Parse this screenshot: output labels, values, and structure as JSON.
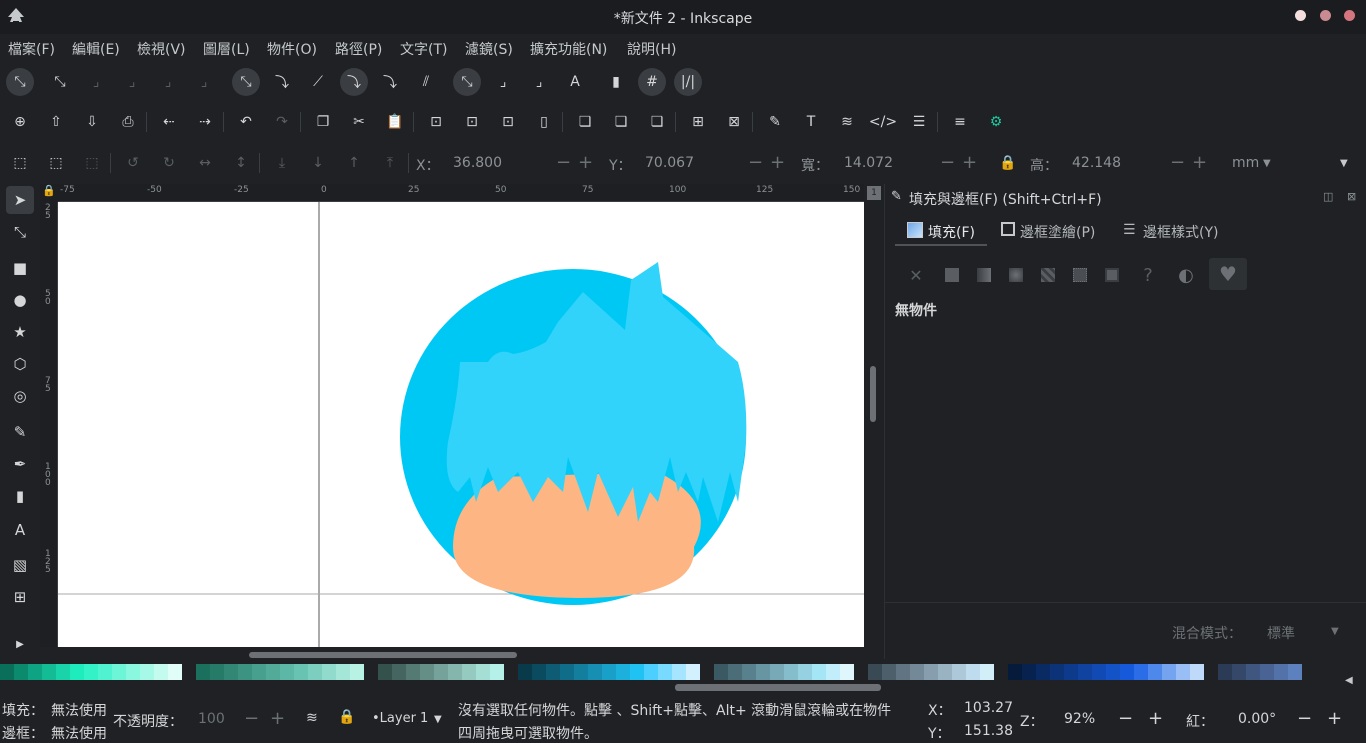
{
  "window": {
    "title": "*新文件 2 - Inkscape"
  },
  "menu": [
    "檔案(F)",
    "編輯(E)",
    "檢視(V)",
    "圖層(L)",
    "物件(O)",
    "路徑(P)",
    "文字(T)",
    "濾鏡(S)",
    "擴充功能(N)",
    "說明(H)"
  ],
  "tool_controls": {
    "x_label": "X：",
    "x_value": "36.800",
    "y_label": "Y：",
    "y_value": "70.067",
    "w_label": "寬：",
    "w_value": "14.072",
    "h_label": "高：",
    "h_value": "42.148",
    "unit": "mm"
  },
  "ruler_top_labels": [
    "-75",
    "-50",
    "-25",
    "0",
    "25",
    "50",
    "75",
    "100",
    "125",
    "150"
  ],
  "ruler_left_labels": [
    "2\n5",
    "5\n0",
    "7\n5",
    "1\n0\n0",
    "1\n2\n5"
  ],
  "panel": {
    "title": "填充與邊框(F) (Shift+Ctrl+F)",
    "tabs": [
      "填充(F)",
      "邊框塗繪(P)",
      "邊框樣式(Y)"
    ],
    "no_object": "無物件",
    "blend_label": "混合模式：",
    "blend_value": "標準"
  },
  "status": {
    "fill_label": "填充：",
    "fill_value": "無法使用",
    "stroke_label": "邊框：",
    "stroke_value": "無法使用",
    "opacity_label": "不透明度：",
    "opacity_value": "100",
    "layer": "•Layer 1",
    "message_line1": "沒有選取任何物件。點擊 、Shift+點擊、Alt+ 滾動滑鼠滾輪或在物件",
    "message_line2": "四周拖曳可選取物件。",
    "cx_label": "X：",
    "cx_value": "103.27",
    "cy_label": "Y：",
    "cy_value": "151.38",
    "zoom_label": "Z：",
    "zoom_value": "92%",
    "rot_label": "紅：",
    "rot_value": "0.00°"
  },
  "colors": {
    "circle": "#00c8f5",
    "hair": "#31d3fa",
    "skin": "#fdb583",
    "ui_bg": "#1f2124"
  },
  "palette": [
    "#0a6f5a",
    "#0b8a6d",
    "#0ea382",
    "#13bc95",
    "#19d4a9",
    "#1eecbc",
    "#33f2c8",
    "#4ff3cf",
    "#6cf5d7",
    "#8af7df",
    "#a7f9e7",
    "#c4fbef",
    "#e1fdf7",
    "#1f2124",
    "#1b6f5d",
    "#267b68",
    "#318774",
    "#3c9381",
    "#479f8d",
    "#52ab99",
    "#5db7a6",
    "#68c3b2",
    "#7ccfbf",
    "#90dbcb",
    "#a4e6d8",
    "#b8f2e4",
    "#1f2124",
    "#35514c",
    "#456660",
    "#557a73",
    "#658e87",
    "#75a29a",
    "#85b6ae",
    "#95cac1",
    "#a5ded5",
    "#b5f1e8",
    "#1f2124",
    "#083a4a",
    "#0a4b5f",
    "#0d5c74",
    "#106d89",
    "#137e9e",
    "#168fb3",
    "#19a0c8",
    "#1cb1dd",
    "#1fc2f2",
    "#4ccfff",
    "#79daff",
    "#a6e5ff",
    "#d3f0ff",
    "#1f2124",
    "#3b5963",
    "#4a6d78",
    "#59818d",
    "#6895a2",
    "#77a9b7",
    "#86bdcc",
    "#95d1e1",
    "#a4e5f6",
    "#c2edfa",
    "#e0f6fd",
    "#1f2124",
    "#3a4a55",
    "#4d5f6b",
    "#607481",
    "#738997",
    "#869ead",
    "#99b3c3",
    "#acc8d9",
    "#bfdcee",
    "#d2eff9",
    "#1f2124",
    "#061a3b",
    "#08224f",
    "#0a2a63",
    "#0c3277",
    "#0e3a8b",
    "#10429f",
    "#124ab3",
    "#1452c7",
    "#165adb",
    "#2a6de6",
    "#4f88eb",
    "#74a3f0",
    "#99bef5",
    "#bed9fa",
    "#1f2124",
    "#2b3a55",
    "#35486a",
    "#3f567f",
    "#496494",
    "#5372a9",
    "#5d80be"
  ]
}
